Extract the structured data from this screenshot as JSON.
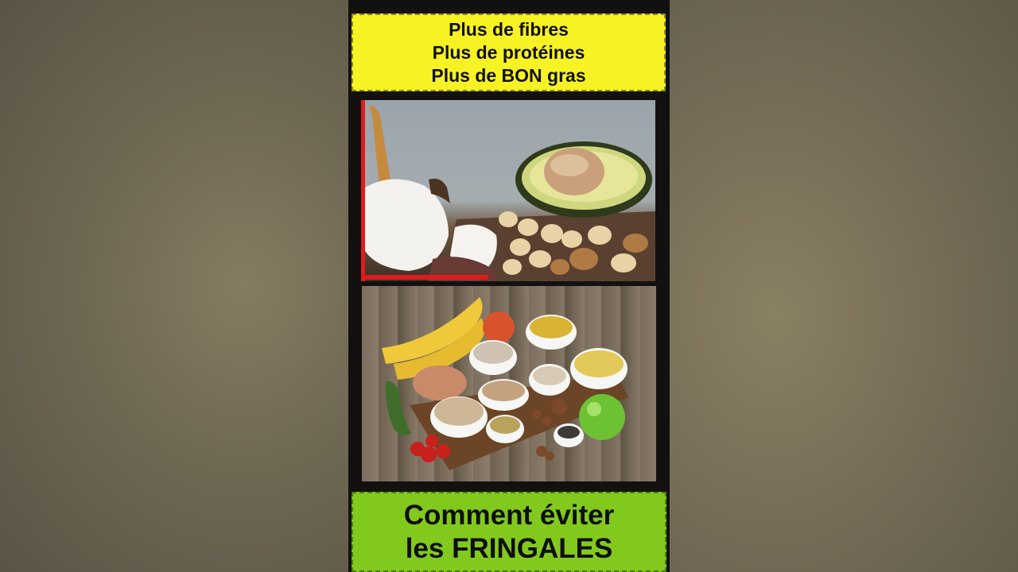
{
  "banner_top": {
    "line1": "Plus de fibres",
    "line2": "Plus de protéines",
    "line3": "Plus de BON gras"
  },
  "images": {
    "top_photo": "coconut-avocado-nuts-photo",
    "bottom_photo": "bananas-bowls-grains-vegetables-photo"
  },
  "banner_bottom": {
    "line1": "Comment éviter",
    "line2": "les FRINGALES"
  },
  "colors": {
    "top_banner": "#f7f224",
    "bottom_banner": "#82c91e",
    "accent_red": "#e01b1b"
  }
}
